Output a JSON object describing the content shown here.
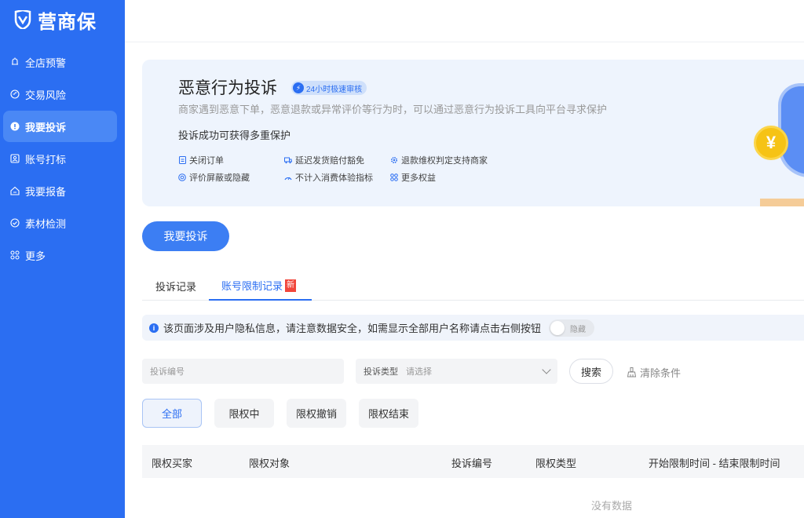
{
  "brand": {
    "name": "营商保",
    "color": "#2b6ef2"
  },
  "sidebar": {
    "items": [
      {
        "label": "全店预警",
        "icon": "bell-icon",
        "active": false
      },
      {
        "label": "交易风险",
        "icon": "risk-icon",
        "active": false
      },
      {
        "label": "我要投诉",
        "icon": "complaint-icon",
        "active": true
      },
      {
        "label": "账号打标",
        "icon": "tag-icon",
        "active": false
      },
      {
        "label": "我要报备",
        "icon": "report-icon",
        "active": false
      },
      {
        "label": "素材检测",
        "icon": "check-icon",
        "active": false
      },
      {
        "label": "更多",
        "icon": "more-grid-icon",
        "active": false
      }
    ]
  },
  "banner": {
    "title": "恶意行为投诉",
    "badge": "24小时极速审核",
    "desc": "商家遇到恶意下单，恶意退款或异常评价等行为时，可以通过恶意行为投诉工具向平台寻求保护",
    "sub": "投诉成功可获得多重保护",
    "benefits": [
      {
        "label": "关闭订单",
        "icon": "document-icon"
      },
      {
        "label": "延迟发货赔付豁免",
        "icon": "truck-icon"
      },
      {
        "label": "退款维权判定支持商家",
        "icon": "gear-icon"
      },
      {
        "label": "评价屏蔽或隐藏",
        "icon": "eye-icon"
      },
      {
        "label": "不计入消费体验指标",
        "icon": "gauge-icon"
      },
      {
        "label": "更多权益",
        "icon": "grid-icon"
      }
    ],
    "coin_symbol": "¥"
  },
  "primary_button": "我要投诉",
  "tabs": [
    {
      "label": "投诉记录",
      "active": false
    },
    {
      "label": "账号限制记录",
      "active": true,
      "badge": "新"
    }
  ],
  "notice": {
    "text": "该页面涉及用户隐私信息，请注意数据安全，如需显示全部用户名称请点击右侧按钮",
    "toggle_label": "隐藏"
  },
  "filters": {
    "complaint_no_placeholder": "投诉编号",
    "type_label": "投诉类型",
    "type_placeholder": "请选择",
    "search": "搜索",
    "clear": "清除条件"
  },
  "status_chips": [
    "全部",
    "限权中",
    "限权撤销",
    "限权结束"
  ],
  "table": {
    "columns": [
      "限权买家",
      "限权对象",
      "投诉编号",
      "限权类型",
      "开始限制时间 - 结束限制时间"
    ],
    "empty_text": "没有数据"
  }
}
